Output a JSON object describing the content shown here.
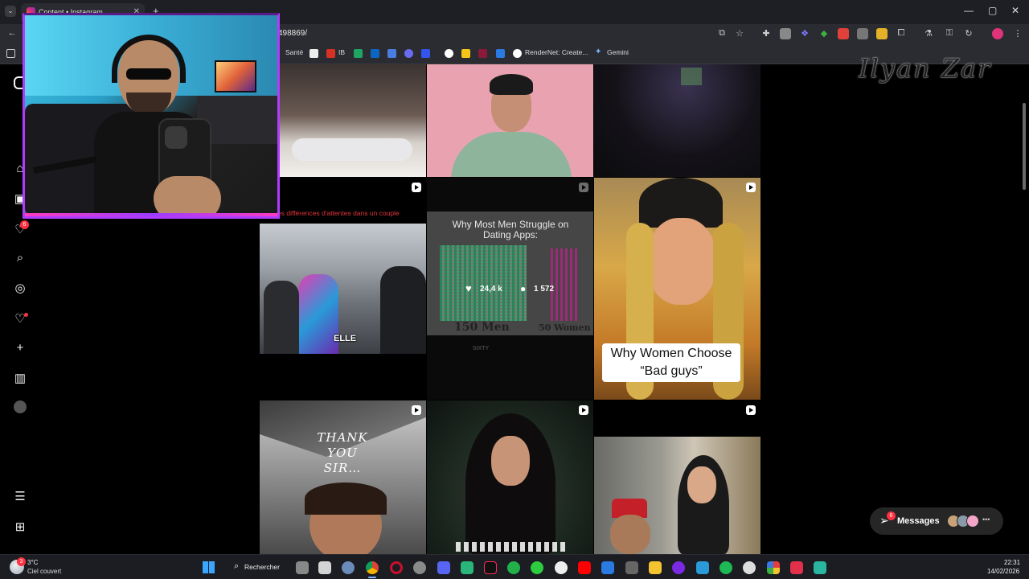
{
  "browser": {
    "tab_title": "Content • Instagram",
    "url": "498869/",
    "bookmarks": [
      "Santé",
      "IB",
      "RenderNet: Create...",
      "Gemini"
    ]
  },
  "watermark": "Ilyan Zar",
  "sidebar": {
    "notifications_badge": "6"
  },
  "posts": {
    "top_banner_text": "es différences d'attentes dans un couple",
    "street_caption": "ELLE",
    "dating_title": "Why Most Men Struggle on Dating Apps:",
    "dating_men": "150 Men",
    "dating_women": "50 Women",
    "dating_watermark": "SIXTY",
    "likes": "24,4 k",
    "comments": "1 572",
    "bad_guys_caption": "Why Women Choose “Bad guys”",
    "thank_you_caption": "THANK YOU SIR…"
  },
  "messages": {
    "label": "Messages",
    "badge": "6"
  },
  "taskbar": {
    "weather_temp": "3°C",
    "weather_desc": "Ciel couvert",
    "search_label": "Rechercher",
    "time": "22:31",
    "date": "14/02/2026",
    "badge": "3"
  },
  "colors": {
    "accent": "#ff3040",
    "background": "#000000"
  }
}
